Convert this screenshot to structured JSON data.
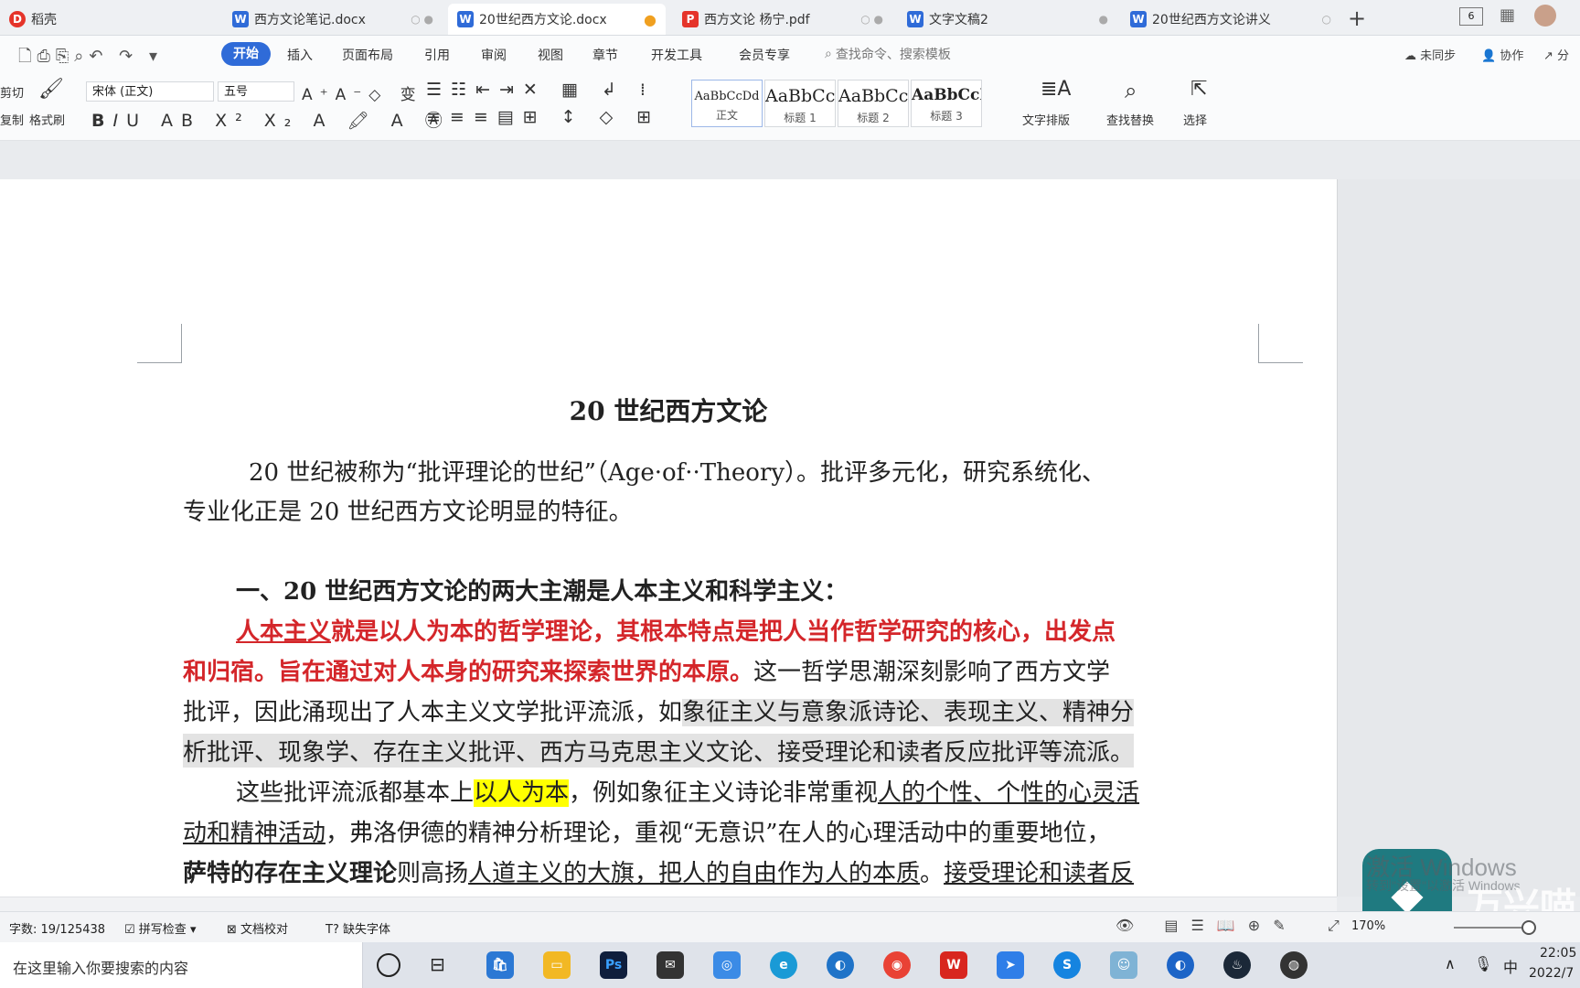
{
  "tabs": [
    {
      "label": "稻壳",
      "icon": "daoke-logo-icon",
      "color": "#e5342a"
    },
    {
      "label": "西方文论笔记.docx",
      "icon": "word-doc-icon",
      "color": "#2f6bd8"
    },
    {
      "label": "20世纪西方文论.docx",
      "icon": "word-doc-icon",
      "color": "#2f6bd8"
    },
    {
      "label": "西方文论 杨宁.pdf",
      "icon": "pdf-icon",
      "color": "#e5342a"
    },
    {
      "label": "文字文稿2",
      "icon": "word-doc-icon",
      "color": "#2f6bd8"
    },
    {
      "label": "20世纪西方文论讲义",
      "icon": "word-doc-icon",
      "color": "#2f6bd8"
    }
  ],
  "tabbar_right": {
    "page_count": "6"
  },
  "menu": {
    "items": [
      "开始",
      "插入",
      "页面布局",
      "引用",
      "审阅",
      "视图",
      "章节",
      "开发工具",
      "会员专享"
    ],
    "search_placeholder": "查找命令、搜索模板",
    "sync": "未同步",
    "collab": "协作",
    "share": "分"
  },
  "ribbon": {
    "cut": "剪切",
    "copy": "复制",
    "format_painter": "格式刷",
    "font": "宋体 (正文)",
    "size": "五号",
    "styles": [
      {
        "preview": "AaBbCcDd",
        "label": "正文"
      },
      {
        "preview": "AaBbCc",
        "label": "标题 1"
      },
      {
        "preview": "AaBbCc",
        "label": "标题 2"
      },
      {
        "preview": "AaBbCcI",
        "label": "标题 3"
      }
    ],
    "text_layout": "文字排版",
    "find_replace": "查找替换",
    "select": "选择"
  },
  "document": {
    "title": "20 世纪西方文论",
    "p1_a": "20 世纪被称为“批评理论的世纪”（Age·of··Theory）。批评多元化，研究系统化、",
    "p1_b": "专业化正是 20 世纪西方文论明显的特征。",
    "h1": "一、20 世纪西方文论的两大主潮是人本主义和科学主义：",
    "l3_red_ul": "人本主义",
    "l3_red": "就是以人为本的哲学理论，其根本特点是把人当作哲学研究的核心，出发点",
    "l4_red": "和归宿。旨在通过对人本身的研究来探索世界的本原。",
    "l4_rest": "这一哲学思潮深刻影响了西方文学",
    "l5_a": "批评，因此涌现出了人本主义文学批评流派，如",
    "l5_b": "象征主义与意象派诗论、表现主义、精神分",
    "l6": "析批评、现象学、存在主义批评、西方马克思主义文论、接受理论和读者反应批评等流派。",
    "l7_a": "这些批评流派都基本上",
    "l7_hl": "以人为本",
    "l7_b": "，例如象征主义诗论非常重视",
    "l7_ul": "人的个性、个性的心灵活",
    "l8_ul": "动和精神活动",
    "l8_b": "，弗洛伊德的精神分析理论，重视“无意识”在人的心理活动中的重要地位，",
    "l9_bold": "萨特的存在主义理论",
    "l9_a": "则高扬",
    "l9_ul": "人道主义的大旗，把人的自由作为人的本质",
    "l9_b": "。",
    "l9_ul2": "接受理论和读者反"
  },
  "statusbar": {
    "wordcount": "字数: 19/125438",
    "spellcheck": "拼写检查",
    "doc_compare": "文档校对",
    "missing_font": "缺失字体",
    "zoom": "170%"
  },
  "taskbar": {
    "search": "在这里输入你要搜索的内容",
    "ime": "中",
    "time": "22:05",
    "date": "2022/7"
  },
  "overlay": {
    "activate": "激活 Windows",
    "activate_sub": "转到\"设置\"以激活 Windows",
    "watermark": "万兴喵"
  },
  "colors": {
    "accent": "#2f6bd8",
    "red_text": "#d4262a",
    "highlight": "#ffff00"
  }
}
